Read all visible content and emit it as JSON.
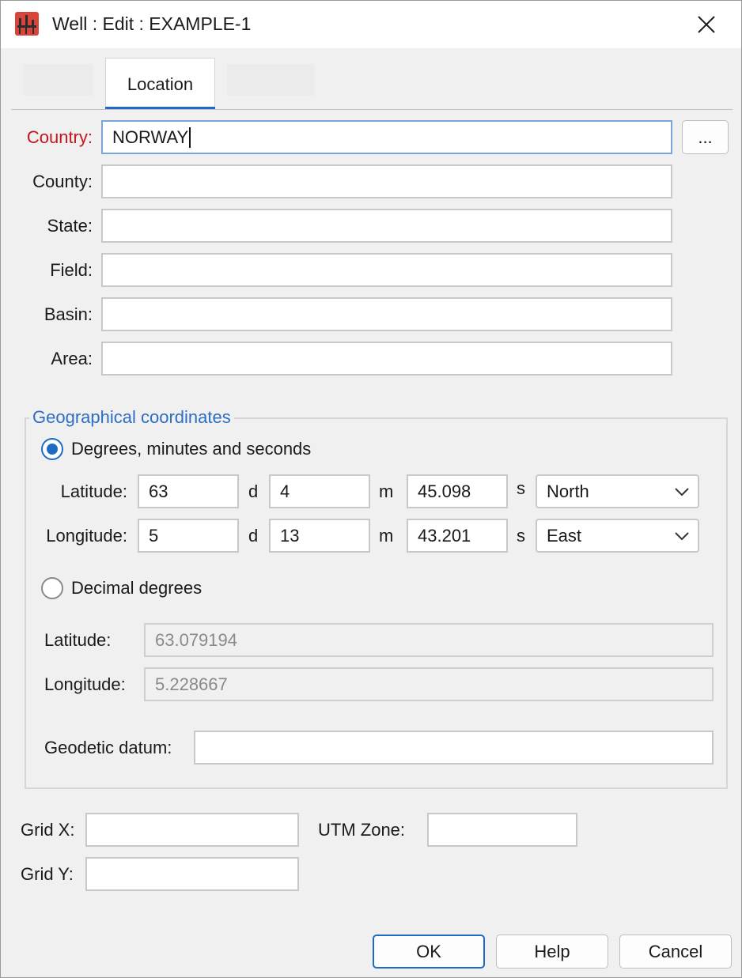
{
  "window": {
    "title": "Well : Edit : EXAMPLE-1"
  },
  "tabs": [
    {
      "label": "Location"
    }
  ],
  "fields": {
    "country": {
      "label": "Country:",
      "value": "NORWAY"
    },
    "county": {
      "label": "County:",
      "value": ""
    },
    "state": {
      "label": "State:",
      "value": ""
    },
    "field": {
      "label": "Field:",
      "value": ""
    },
    "basin": {
      "label": "Basin:",
      "value": ""
    },
    "area": {
      "label": "Area:",
      "value": ""
    },
    "browse_label": "..."
  },
  "geo": {
    "group_title": "Geographical coordinates",
    "dms_label": "Degrees, minutes and seconds",
    "dms_selected": true,
    "lat_label": "Latitude:",
    "lon_label": "Longitude:",
    "deg_unit": "d",
    "min_unit": "m",
    "sec_unit": "s",
    "lat": {
      "deg": "63",
      "min": "4",
      "sec": "45.098",
      "hemi": "North"
    },
    "lon": {
      "deg": "5",
      "min": "13",
      "sec": "43.201",
      "hemi": "East"
    },
    "decimal_label": "Decimal degrees",
    "decimal_selected": false,
    "dec_lat_label": "Latitude:",
    "dec_lon_label": "Longitude:",
    "dec_lat": "63.079194",
    "dec_lon": "5.228667",
    "datum_label": "Geodetic datum:",
    "datum": ""
  },
  "grid": {
    "x_label": "Grid X:",
    "x": "",
    "y_label": "Grid Y:",
    "y": "",
    "utm_label": "UTM Zone:",
    "utm": ""
  },
  "buttons": {
    "ok": "OK",
    "help": "Help",
    "cancel": "Cancel"
  },
  "colors": {
    "accent": "#1f6ac6",
    "required": "#c4161c",
    "group_title": "#2d6dc4"
  },
  "icons": {
    "app": "well-app-icon",
    "close": "close-icon",
    "dropdown": "chevron-down-icon"
  }
}
